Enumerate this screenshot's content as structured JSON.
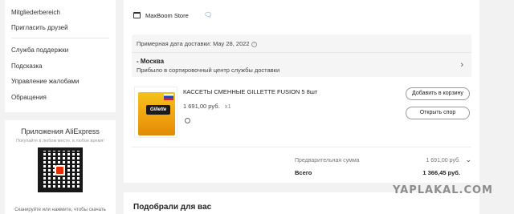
{
  "sidebar": {
    "items": [
      {
        "label": "Mitgliederbereich"
      },
      {
        "label": "Пригласить друзей"
      },
      {
        "label": "Служба поддержки"
      },
      {
        "label": "Подсказка"
      },
      {
        "label": "Управление жалобами"
      },
      {
        "label": "Обращения"
      }
    ]
  },
  "app_promo": {
    "title": "Приложения AliExpress",
    "subtitle": "Покупайте в любом месте, в любое время!",
    "bottom_text": "Сканируйте или нажмите, чтобы скачать"
  },
  "order": {
    "store_name": "MaxBoom Store",
    "delivery_date": "Примерная дата доставки: May 28, 2022",
    "city": "- Москва",
    "status": "Прибыло в сортировочный центр службы доставки",
    "product": {
      "title": "КАССЕТЫ СМЕННЫЕ GILLETTE FUSION 5 8шт",
      "price": "1 691,00 руб.",
      "qty": "x1",
      "image_brand": "Gillette"
    },
    "buttons": {
      "add_to_cart": "Добавить в корзину",
      "open_dispute": "Открыть спор"
    },
    "subtotal_label": "Предварительная сумма",
    "subtotal_value": "1 691,00 руб.",
    "total_label": "Всего",
    "total_value": "1 366,45 руб."
  },
  "recommendations": {
    "title": "Подобрали для вас"
  },
  "watermark": "YAPLAKAL.COM",
  "colors": {
    "accent": "#3a7bd5",
    "brand": "#e62e04",
    "background": "#f2f2f2"
  }
}
